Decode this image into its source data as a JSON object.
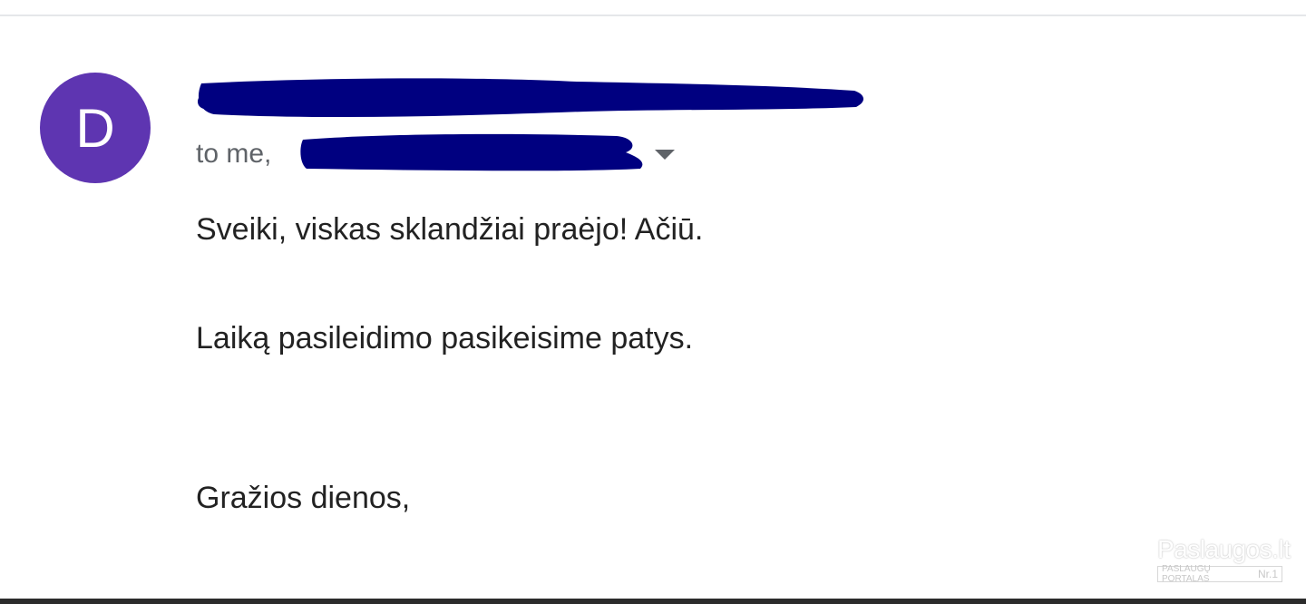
{
  "email": {
    "sender": {
      "avatar_letter": "D",
      "avatar_color": "#5e35b1"
    },
    "recipient_prefix": "to me,",
    "redaction_color": "#000080",
    "body_lines": [
      "Sveiki, viskas sklandžiai praėjo! Ačiū.",
      "Laiką pasileidimo pasikeisime patys.",
      "Gražios dienos,"
    ]
  },
  "watermark": {
    "title": "Paslaugos.lt",
    "subtitle": "PASLAUGŲ PORTALAS",
    "badge": "Nr.1"
  },
  "icons": {
    "recipient_dropdown": "caret-down-icon"
  }
}
